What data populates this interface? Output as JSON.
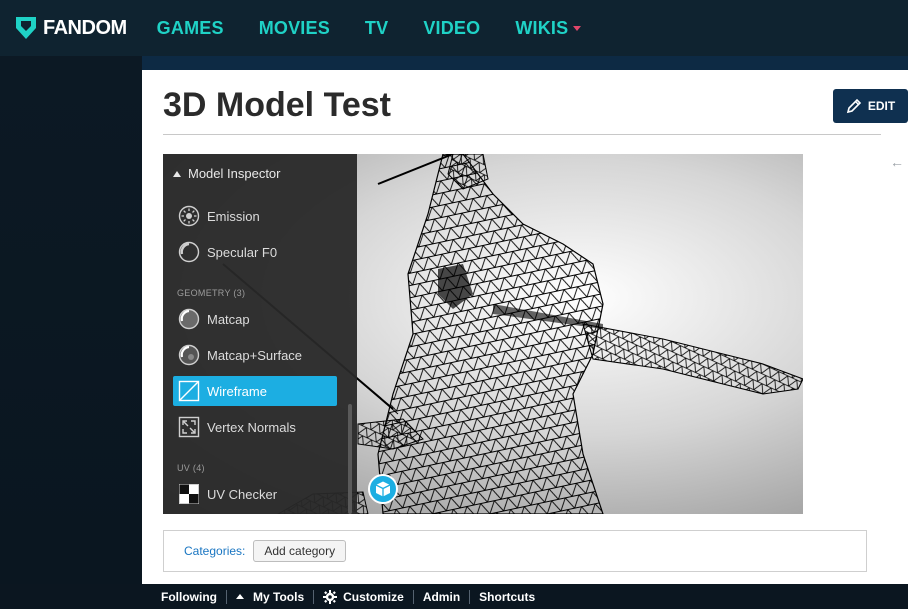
{
  "brand": {
    "name": "FANDOM",
    "accent": "#1fd2c6",
    "caret_color": "#e0466a"
  },
  "nav": {
    "items": [
      {
        "label": "GAMES"
      },
      {
        "label": "MOVIES"
      },
      {
        "label": "TV"
      },
      {
        "label": "VIDEO"
      },
      {
        "label": "WIKIS"
      }
    ]
  },
  "page": {
    "title": "3D Model Test",
    "edit_label": "EDIT"
  },
  "inspector": {
    "title": "Model Inspector",
    "items_top": [
      {
        "label": "Emission",
        "icon": "emission-icon"
      },
      {
        "label": "Specular F0",
        "icon": "specular-icon"
      }
    ],
    "geometry_section": "GEOMETRY (3)",
    "geometry_items": [
      {
        "label": "Matcap",
        "icon": "matcap-icon"
      },
      {
        "label": "Matcap+Surface",
        "icon": "matcap-surface-icon"
      },
      {
        "label": "Wireframe",
        "icon": "wireframe-icon",
        "active": true
      },
      {
        "label": "Vertex Normals",
        "icon": "vertex-normals-icon"
      }
    ],
    "uv_section": "UV (4)",
    "uv_items": [
      {
        "label": "UV Checker",
        "icon": "uv-checker-icon"
      }
    ],
    "active_color": "#1caee2"
  },
  "categories": {
    "label": "Categories:",
    "add_label": "Add category"
  },
  "toolbar": {
    "following": "Following",
    "my_tools": "My Tools",
    "customize": "Customize",
    "admin": "Admin",
    "shortcuts": "Shortcuts"
  }
}
